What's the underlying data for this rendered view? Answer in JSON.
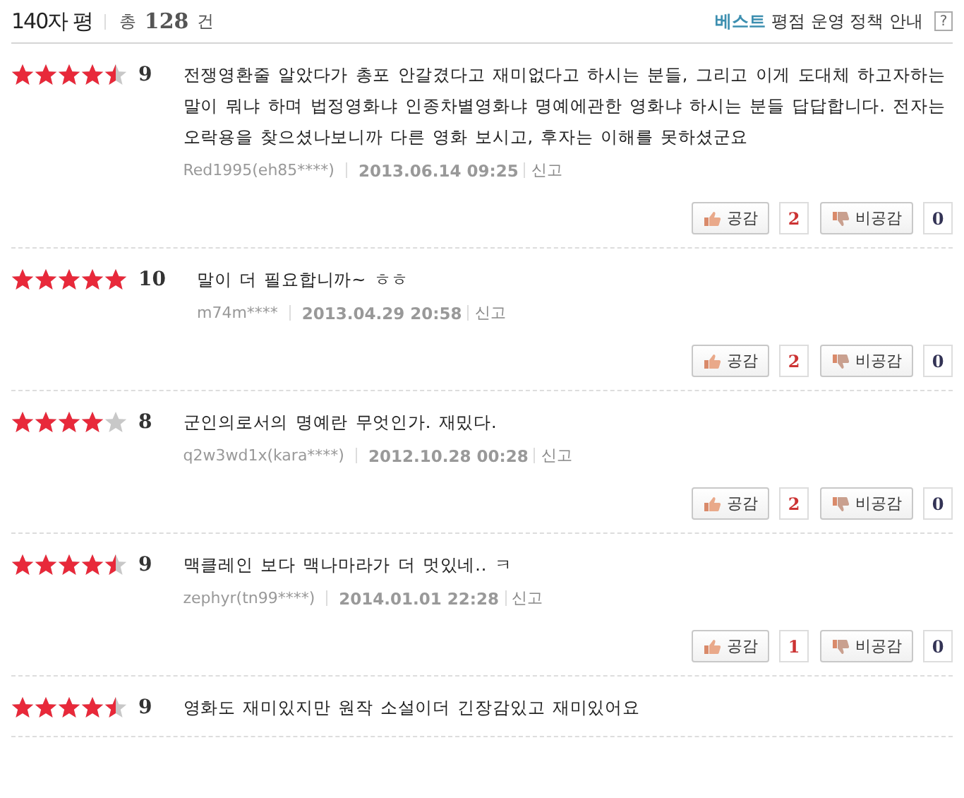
{
  "header": {
    "title": "140자 평",
    "total_prefix": "총",
    "total_count": "128",
    "total_suffix": "건",
    "policy_highlight": "베스트",
    "policy_text": "평점 운영 정책 안내",
    "help": "?"
  },
  "reviews": [
    {
      "stars": 4.5,
      "score": "9",
      "text": "전쟁영환줄 알았다가 총포 안갈겼다고 재미없다고 하시는 분들, 그리고 이게 도대체 하고자하는 말이 뭐냐 하며 법정영화냐 인종차별영화냐 명예에관한 영화냐 하시는 분들 답답합니다. 전자는 오락용을 찾으셨나보니까 다른 영화 보시고, 후자는 이해를 못하셨군요",
      "user": "Red1995(eh85****)",
      "date": "2013.06.14 09:25",
      "report": "신고",
      "like_label": "공감",
      "likes": "2",
      "dislike_label": "비공감",
      "dislikes": "0"
    },
    {
      "stars": 5,
      "score": "10",
      "text": "말이 더 필요합니까~ ㅎㅎ",
      "user": "m74m****",
      "date": "2013.04.29 20:58",
      "report": "신고",
      "like_label": "공감",
      "likes": "2",
      "dislike_label": "비공감",
      "dislikes": "0"
    },
    {
      "stars": 4,
      "score": "8",
      "text": "군인의로서의 명예란 무엇인가. 재밌다.",
      "user": "q2w3wd1x(kara****)",
      "date": "2012.10.28 00:28",
      "report": "신고",
      "like_label": "공감",
      "likes": "2",
      "dislike_label": "비공감",
      "dislikes": "0"
    },
    {
      "stars": 4.5,
      "score": "9",
      "text": "맥클레인 보다 맥나마라가 더 멋있네.. ㅋ",
      "user": "zephyr(tn99****)",
      "date": "2014.01.01 22:28",
      "report": "신고",
      "like_label": "공감",
      "likes": "1",
      "dislike_label": "비공감",
      "dislikes": "0"
    },
    {
      "stars": 4.5,
      "score": "9",
      "text": "영화도 재미있지만 원작 소설이더 긴장감있고 재미있어요"
    }
  ]
}
